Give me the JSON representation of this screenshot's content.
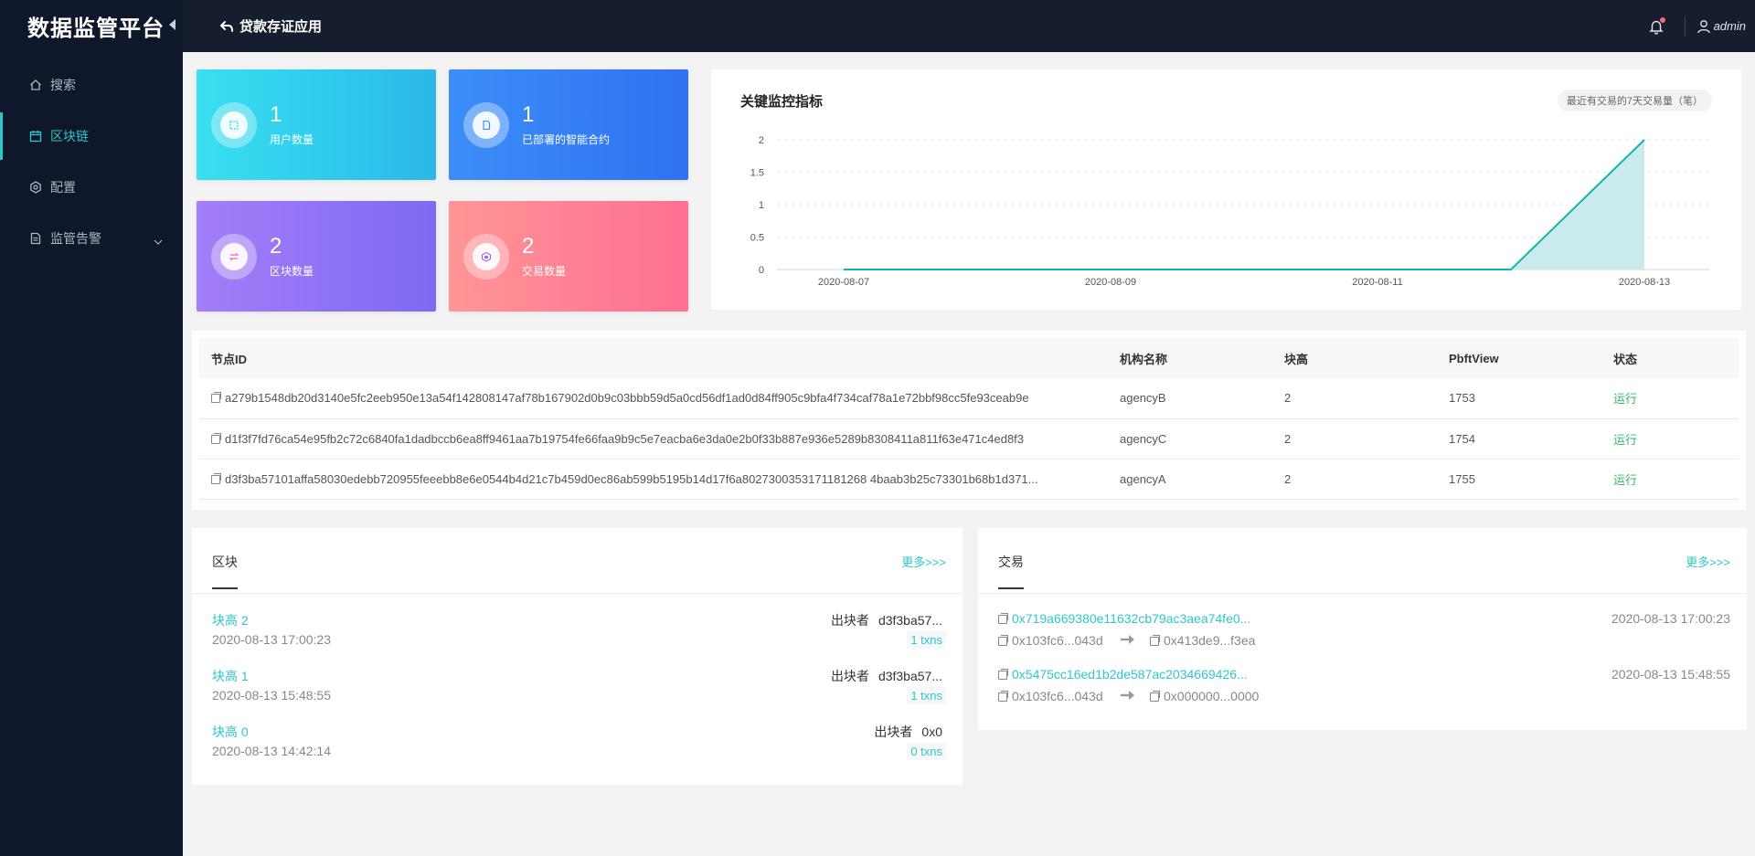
{
  "app": {
    "title": "数据监管平台"
  },
  "sidebar": {
    "items": [
      {
        "label": "搜索",
        "icon": "home-icon"
      },
      {
        "label": "区块链",
        "icon": "calendar-icon",
        "active": true
      },
      {
        "label": "配置",
        "icon": "gear-icon"
      },
      {
        "label": "监管告警",
        "icon": "document-icon"
      }
    ]
  },
  "header": {
    "back_label": "贷款存证应用",
    "user": "admin"
  },
  "stats": [
    {
      "value": "1",
      "label": "用户数量"
    },
    {
      "value": "1",
      "label": "已部署的智能合约"
    },
    {
      "value": "2",
      "label": "区块数量"
    },
    {
      "value": "2",
      "label": "交易数量"
    }
  ],
  "chart_panel": {
    "title": "关键监控指标",
    "tag": "最近有交易的7天交易量（笔）"
  },
  "chart_data": {
    "type": "area",
    "x": [
      "2020-08-07",
      "2020-08-08",
      "2020-08-09",
      "2020-08-10",
      "2020-08-11",
      "2020-08-12",
      "2020-08-13"
    ],
    "series": [
      {
        "values": [
          0,
          0,
          0,
          0,
          0,
          0,
          2
        ]
      }
    ],
    "ylim": [
      0,
      2
    ],
    "yticks": [
      "0",
      "0.5",
      "1",
      "1.5",
      "2"
    ],
    "xtick_labels": [
      "2020-08-07",
      "2020-08-09",
      "2020-08-11",
      "2020-08-13"
    ],
    "line_color": "#13b5b1",
    "fill_color": "#c9ebee",
    "grid": true
  },
  "nodes": {
    "headers": [
      "节点ID",
      "机构名称",
      "块高",
      "PbftView",
      "状态"
    ],
    "rows": [
      {
        "id": "a279b1548db20d3140e5fc2eeb950e13a54f142808147af78b167902d0b9c03bbb59d5a0cd56df1ad0d84ff905c9bfa4f734caf78a1e72bbf98cc5fe93ceab9e",
        "agency": "agencyB",
        "height": "2",
        "view": "1753",
        "status": "运行"
      },
      {
        "id": "d1f3f7fd76ca54e95fb2c72c6840fa1dadbccb6ea8ff9461aa7b19754fe66faa9b9c5e7eacba6e3da0e2b0f33b887e936e5289b8308411a811f63e471c4ed8f3",
        "agency": "agencyC",
        "height": "2",
        "view": "1754",
        "status": "运行"
      },
      {
        "id": "d3f3ba57101affa58030edebb720955feeebb8e6e0544b4d21c7b459d0ec86ab599b5195b14d17f6a8027300353171181268 4baab3b25c73301b68b1d371...",
        "agency": "agencyA",
        "height": "2",
        "view": "1755",
        "status": "运行"
      }
    ]
  },
  "blocks": {
    "title": "区块",
    "more": "更多>>>",
    "miner_label": "出块者",
    "items": [
      {
        "height": "块高 2",
        "time": "2020-08-13 17:00:23",
        "miner": "d3f3ba57...",
        "txns": "1 txns"
      },
      {
        "height": "块高 1",
        "time": "2020-08-13 15:48:55",
        "miner": "d3f3ba57...",
        "txns": "1 txns"
      },
      {
        "height": "块高 0",
        "time": "2020-08-13 14:42:14",
        "miner": "0x0",
        "txns": "0 txns"
      }
    ]
  },
  "txns": {
    "title": "交易",
    "more": "更多>>>",
    "items": [
      {
        "hash": "0x719a669380e11632cb79ac3aea74fe0...",
        "time": "2020-08-13 17:00:23",
        "from": "0x103fc6...043d",
        "to": "0x413de9...f3ea"
      },
      {
        "hash": "0x5475cc16ed1b2de587ac2034669426...",
        "time": "2020-08-13 15:48:55",
        "from": "0x103fc6...043d",
        "to": "0x000000...0000"
      }
    ]
  }
}
